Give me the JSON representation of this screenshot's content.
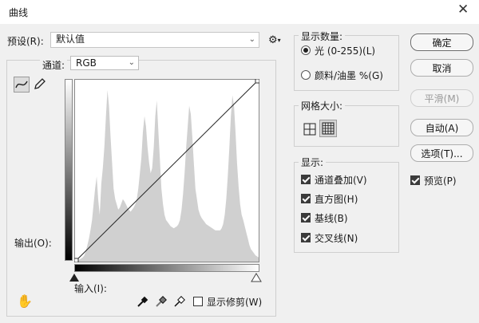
{
  "window": {
    "title": "曲线"
  },
  "preset": {
    "label": "预设(R):",
    "value": "默认值"
  },
  "channel": {
    "label": "通道:",
    "value": "RGB"
  },
  "graph": {
    "output_label": "输出(O):",
    "input_label": "输入(I):"
  },
  "clipping": {
    "label": "显示修剪(W)",
    "checked": false
  },
  "buttons": {
    "ok": "确定",
    "cancel": "取消",
    "smooth": "平滑(M)",
    "auto": "自动(A)",
    "options": "选项(T)...",
    "preview": "预览(P)",
    "preview_checked": true
  },
  "show_amount": {
    "title": "显示数量:",
    "light": "光 (0-255)(L)",
    "pigment": "颜料/油墨 %(G)",
    "selected": "light"
  },
  "grid_size": {
    "title": "网格大小:",
    "selected": "fine"
  },
  "show": {
    "title": "显示:",
    "items": [
      {
        "label": "通道叠加(V)",
        "checked": true
      },
      {
        "label": "直方图(H)",
        "checked": true
      },
      {
        "label": "基线(B)",
        "checked": true
      },
      {
        "label": "交叉线(N)",
        "checked": true
      }
    ]
  },
  "histogram_levels": [
    2,
    2,
    2,
    2,
    3,
    4,
    6,
    10,
    16,
    22,
    30,
    40,
    55,
    70,
    82,
    60,
    45,
    75,
    90,
    110,
    140,
    165,
    150,
    120,
    95,
    70,
    60,
    55,
    50,
    52,
    56,
    60,
    58,
    55,
    52,
    50,
    48,
    50,
    52,
    55,
    60,
    70,
    85,
    100,
    125,
    140,
    130,
    110,
    95,
    85,
    90,
    110,
    140,
    155,
    125,
    98,
    70,
    55,
    45,
    40,
    38,
    36,
    34,
    33,
    32,
    33,
    34,
    36,
    40,
    50,
    65,
    85,
    110,
    130,
    150,
    142,
    120,
    95,
    70,
    60,
    50,
    45,
    42,
    40,
    38,
    36,
    35,
    34,
    33,
    32,
    31,
    30,
    30,
    30,
    30,
    32,
    36,
    45,
    60,
    82,
    110,
    140,
    160,
    150,
    125,
    95,
    72,
    55,
    45,
    40,
    34,
    28,
    22,
    16,
    12,
    10,
    8,
    6,
    5,
    4
  ],
  "colors": {
    "panel": "#f0f0f0",
    "histogram": "#d0d0d0",
    "curve": "#222222"
  }
}
